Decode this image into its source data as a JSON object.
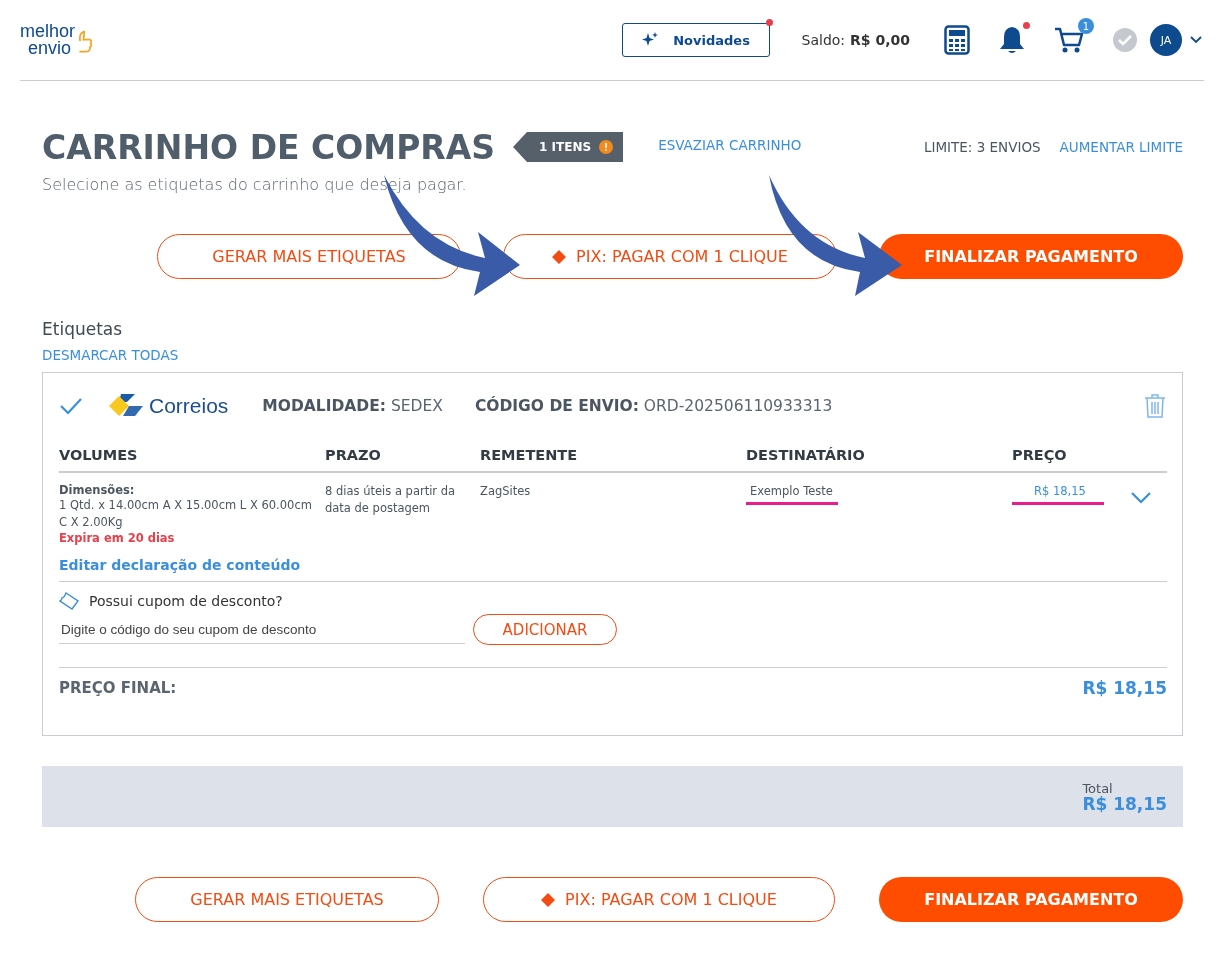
{
  "header": {
    "logo": {
      "line_1": "melhor",
      "line_2": "envio"
    },
    "news_button": "Novidades",
    "balance": {
      "label": "Saldo:",
      "value": "R$ 0,00"
    },
    "cart_count": "1",
    "avatar": "JA"
  },
  "page": {
    "title": "CARRINHO DE COMPRAS",
    "items_badge": "1 ITENS",
    "empty_link": "ESVAZIAR CARRINHO",
    "limit": "LIMITE: 3 ENVIOS",
    "raise_limit": "AUMENTAR LIMITE",
    "subtitle": "Selecione as etiquetas do carrinho que deseja pagar."
  },
  "actions_top": {
    "more_labels": "GERAR MAIS ETIQUETAS",
    "pix": "PIX: PAGAR COM 1 CLIQUE",
    "checkout": "FINALIZAR PAGAMENTO"
  },
  "labels_section": {
    "title": "Etiquetas",
    "unselect_all": "DESMARCAR TODAS"
  },
  "shipment": {
    "selected": true,
    "carrier": "Correios",
    "service_label": "MODALIDADE:",
    "service": "SEDEX",
    "code_label": "CÓDIGO DE ENVIO:",
    "code": "ORD-202506110933313",
    "columns": [
      "VOLUMES",
      "PRAZO",
      "REMETENTE",
      "DESTINATÁRIO",
      "PREÇO"
    ],
    "dimensions_label": "Dimensões:",
    "dimensions": "1 Qtd. x 14.00cm A X 15.00cm L X 60.00cm C X 2.00Kg",
    "expires": "Expira em 20 dias",
    "deadline": "8 dias úteis a partir da data de postagem",
    "sender": "ZagSites",
    "recipient": "Exemplo Teste",
    "price": "R$ 18,15",
    "edit_declaration": "Editar declaração de conteúdo",
    "coupon": {
      "question": "Possui cupom de desconto?",
      "placeholder": "Digite o código do seu cupom de desconto",
      "button": "ADICIONAR"
    },
    "final_price_label": "PREÇO FINAL:",
    "final_price": "R$ 18,15"
  },
  "total": {
    "label": "Total",
    "value": "R$ 18,15"
  },
  "actions_bottom": {
    "more_labels": "GERAR MAIS ETIQUETAS",
    "pix": "PIX: PAGAR COM 1 CLIQUE",
    "checkout": "FINALIZAR PAGAMENTO"
  }
}
